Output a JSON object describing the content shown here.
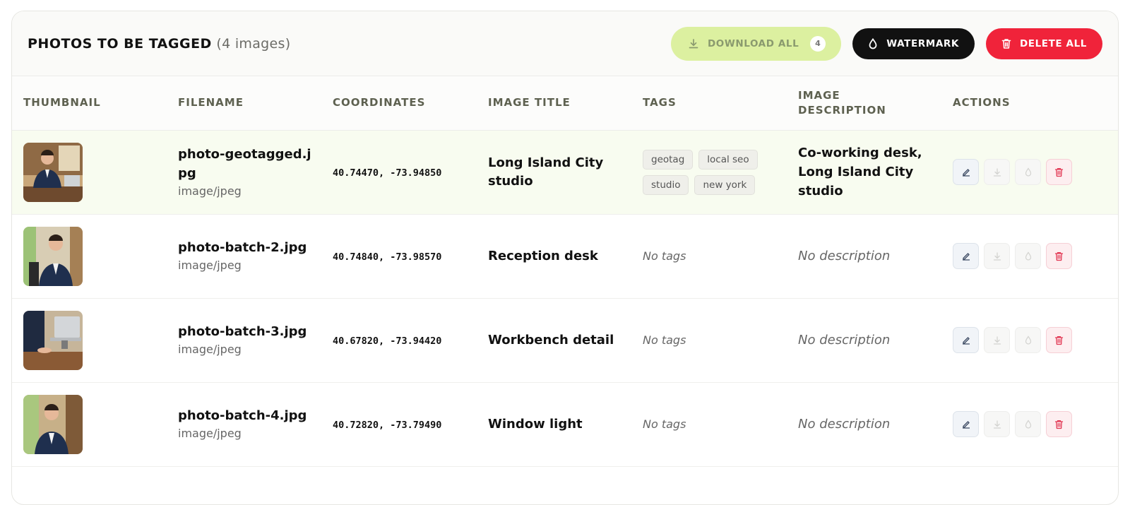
{
  "header": {
    "title": "PHOTOS TO BE TAGGED",
    "count_text": "(4 images)",
    "download_label": "DOWNLOAD ALL",
    "download_count": "4",
    "watermark_label": "WATERMARK",
    "delete_all_label": "DELETE ALL"
  },
  "columns": {
    "thumbnail": "THUMBNAIL",
    "filename": "FILENAME",
    "coordinates": "COORDINATES",
    "image_title": "IMAGE TITLE",
    "tags": "TAGS",
    "image_description": "IMAGE DESCRIPTION",
    "actions": "ACTIONS"
  },
  "rows": [
    {
      "filename": "photo-geotagged.jpg",
      "type": "image/jpeg",
      "coords": "40.74470, -73.94850",
      "title": "Long Island City studio",
      "tags": [
        "geotag",
        "local seo",
        "studio",
        "new york"
      ],
      "description": "Co-working desk, Long Island City studio"
    },
    {
      "filename": "photo-batch-2.jpg",
      "type": "image/jpeg",
      "coords": "40.74840, -73.98570",
      "title": "Reception desk",
      "tags_empty": "No tags",
      "description_empty": "No description"
    },
    {
      "filename": "photo-batch-3.jpg",
      "type": "image/jpeg",
      "coords": "40.67820, -73.94420",
      "title": "Workbench detail",
      "tags_empty": "No tags",
      "description_empty": "No description"
    },
    {
      "filename": "photo-batch-4.jpg",
      "type": "image/jpeg",
      "coords": "40.72820, -73.79490",
      "title": "Window light",
      "tags_empty": "No tags",
      "description_empty": "No description"
    }
  ],
  "colors": {
    "download_bg": "#dcf0a0",
    "watermark_bg": "#111111",
    "delete_bg": "#f0233a",
    "selected_row_bg": "#f8fcf0"
  }
}
